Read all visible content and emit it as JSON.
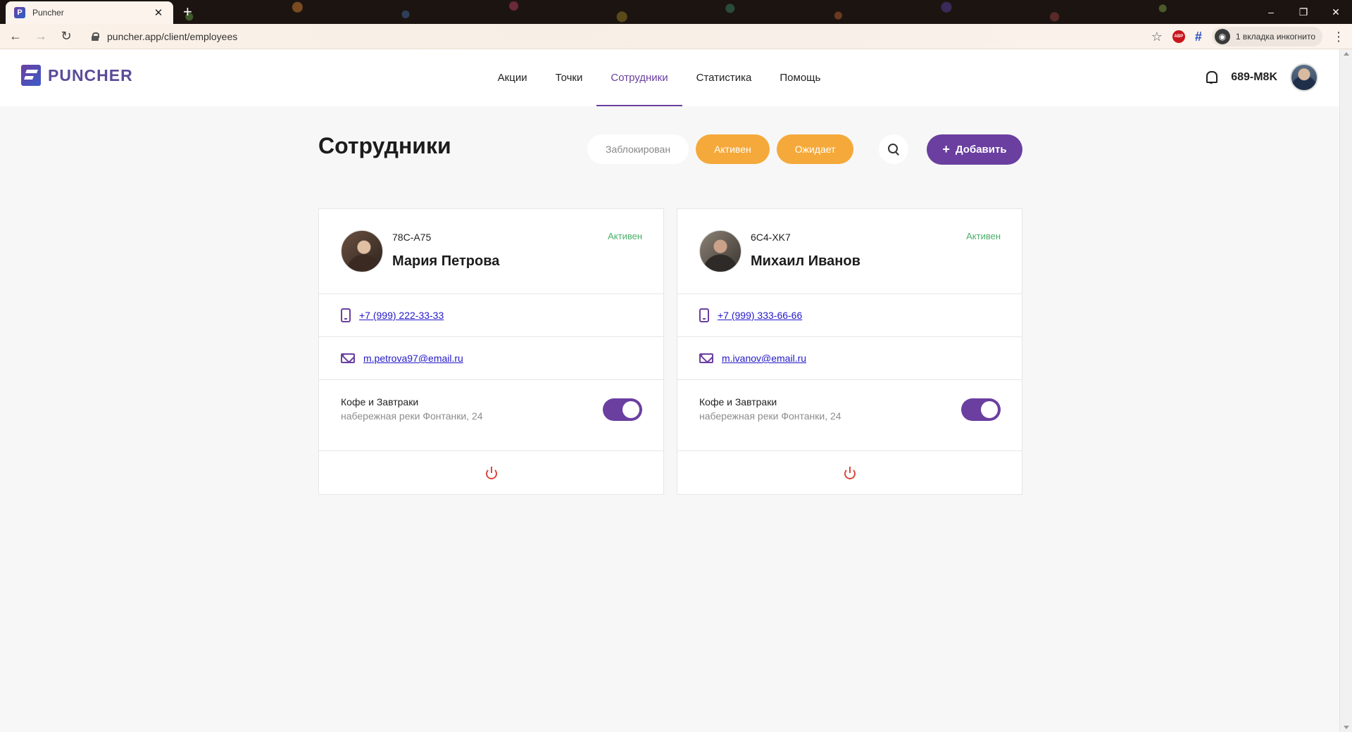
{
  "browser": {
    "tab_title": "Puncher",
    "tab_favicon": "P",
    "url": "puncher.app/client/employees",
    "incognito_label": "1 вкладка инкогнито",
    "window_controls": [
      "–",
      "❐",
      "✕"
    ]
  },
  "header": {
    "logo_text": "PUNCHER",
    "nav": [
      {
        "label": "Акции"
      },
      {
        "label": "Точки"
      },
      {
        "label": "Сотрудники",
        "active": true
      },
      {
        "label": "Статистика"
      },
      {
        "label": "Помощь"
      }
    ],
    "user_code": "689-M8K"
  },
  "page": {
    "title": "Сотрудники",
    "filters": [
      {
        "label": "Заблокирован",
        "selected": false
      },
      {
        "label": "Активен",
        "selected": true
      },
      {
        "label": "Ожидает",
        "selected": true
      }
    ],
    "add_label": "Добавить",
    "add_icon": "+"
  },
  "employees": [
    {
      "code": "78C-A75",
      "name": "Мария Петрова",
      "status": "Активен",
      "phone": "+7 (999) 222-33-33",
      "email": "m.petrova97@email.ru",
      "location_name": "Кофе и Завтраки",
      "location_address": "набережная реки Фонтанки, 24",
      "location_enabled": true
    },
    {
      "code": "6C4-XK7",
      "name": "Михаил Иванов",
      "status": "Активен",
      "phone": "+7 (999) 333-66-66",
      "email": "m.ivanov@email.ru",
      "location_name": "Кофе и Завтраки",
      "location_address": "набережная реки Фонтанки, 24",
      "location_enabled": true
    }
  ],
  "colors": {
    "accent": "#6a3fa0",
    "filter_active": "#f5a93a",
    "status_active": "#4caf6a",
    "power": "#d9483c"
  }
}
